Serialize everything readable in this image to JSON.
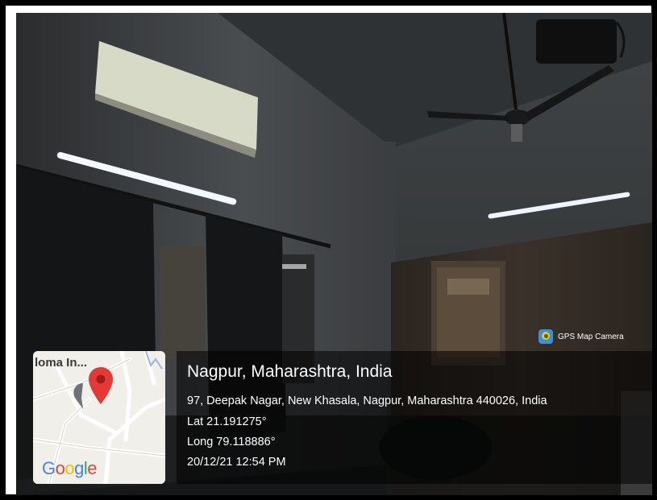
{
  "overlay": {
    "app_badge": "GPS Map Camera",
    "title": "Nagpur, Maharashtra, India",
    "address": "97, Deepak Nagar, New Khasala, Nagpur, Maharashtra 440026, India",
    "latitude": "Lat 21.191275°",
    "longitude": "Long 79.118886°",
    "datetime": "20/12/21 12:54 PM"
  },
  "map_thumbnail": {
    "label": "loma In...",
    "logo_letters": [
      "G",
      "o",
      "o",
      "g",
      "l",
      "e"
    ],
    "logo_colors": [
      "#4285F4",
      "#EA4335",
      "#FBBC05",
      "#4285F4",
      "#34A853",
      "#EA4335"
    ],
    "pin_icon": "map-pin-icon"
  },
  "colors": {
    "photo_dark": "#1c1e20",
    "overlay_bg": "rgba(0,0,0,0.55)",
    "pin_red": "#e53935"
  }
}
